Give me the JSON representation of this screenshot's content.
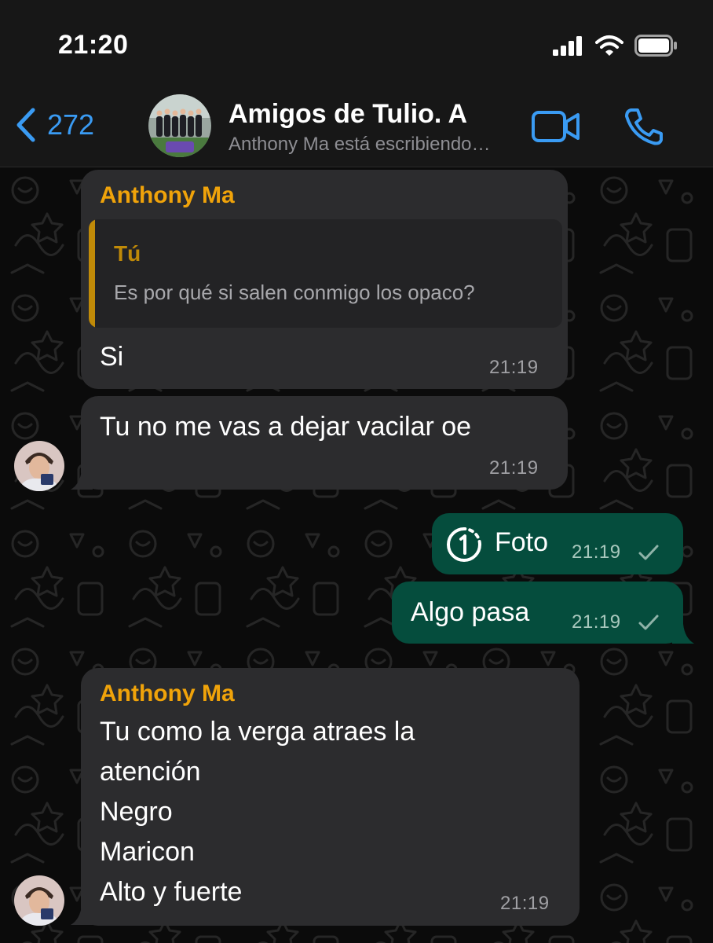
{
  "status_bar": {
    "time": "21:20",
    "signal_icon": "cellular-signal-icon",
    "wifi_icon": "wifi-icon",
    "battery_icon": "battery-icon"
  },
  "header": {
    "back_count": "272",
    "title": "Amigos de Tulio. A",
    "subtitle": "Anthony Ma está escribiendo…",
    "video_icon": "video-camera-icon",
    "call_icon": "phone-icon"
  },
  "colors": {
    "accent_blue": "#3a9bf3",
    "sender_orange": "#f0a30a",
    "incoming_bubble": "#2c2c2e",
    "outgoing_bubble": "#054d3d"
  },
  "messages": [
    {
      "direction": "incoming",
      "sender": "Anthony Ma",
      "quote": {
        "name": "Tú",
        "text": "Es por qué si salen conmigo los opaco?"
      },
      "text": "Si",
      "time": "21:19"
    },
    {
      "direction": "incoming",
      "text": "Tu no me vas a dejar vacilar oe",
      "time": "21:19"
    },
    {
      "direction": "outgoing",
      "icon": "view-once-photo-icon",
      "text": "Foto",
      "time": "21:19",
      "status_icon": "sent-check-icon"
    },
    {
      "direction": "outgoing",
      "text": "Algo pasa",
      "time": "21:19",
      "status_icon": "sent-check-icon"
    },
    {
      "direction": "incoming",
      "sender": "Anthony Ma",
      "lines": [
        "Tu como la verga atraes la",
        "atención",
        "Negro",
        "Maricon",
        "Alto y fuerte"
      ],
      "time": "21:19"
    }
  ]
}
